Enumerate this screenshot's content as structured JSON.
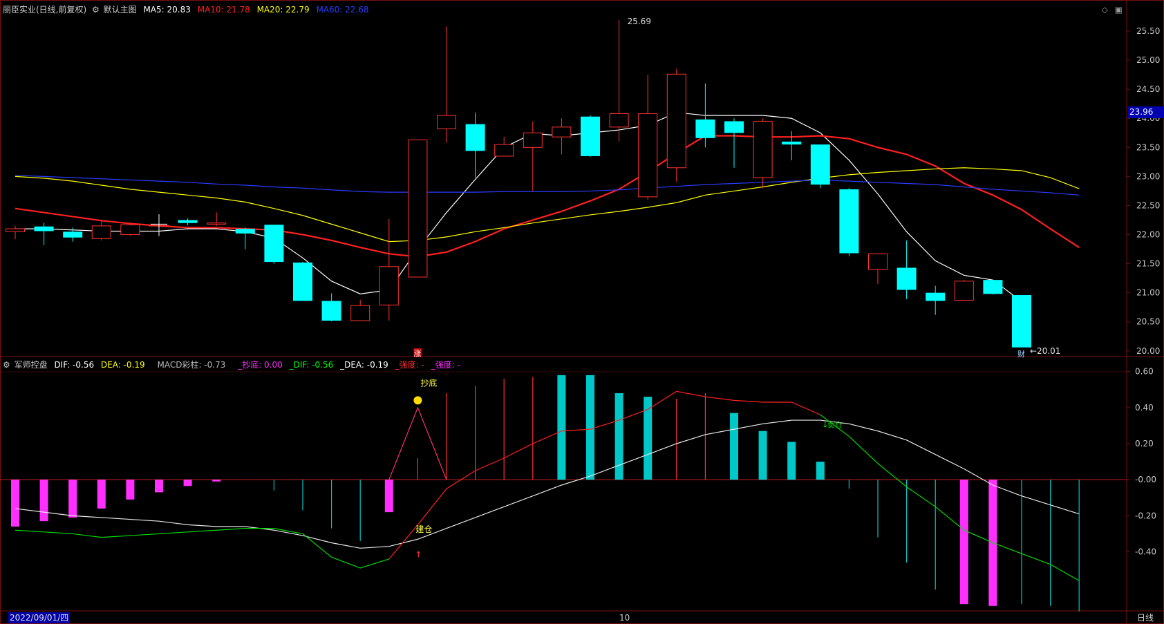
{
  "header": {
    "main": {
      "title": "丽臣实业(日线,前复权)",
      "template": "默认主图",
      "ma": [
        {
          "label": "MA5: 20.83",
          "color": "#ffffff"
        },
        {
          "label": "MA10: 21.78",
          "color": "#ff2020"
        },
        {
          "label": "MA20: 22.79",
          "color": "#ffff00"
        },
        {
          "label": "MA60: 22.68",
          "color": "#2b3cff"
        }
      ]
    },
    "sub": {
      "title": "军师控盘",
      "items": [
        {
          "label": "DIF: -0.56",
          "color": "#ffffff"
        },
        {
          "label": "DEA: -0.19",
          "color": "#ffff00"
        },
        {
          "label": "MACD彩柱: -0.73",
          "color": "#bbbbbb"
        },
        {
          "label": "_抄底: 0.00",
          "color": "#ff30ff"
        },
        {
          "label": "_DIF: -0.56",
          "color": "#00ff00"
        },
        {
          "label": "_DEA: -0.19",
          "color": "#ffffff"
        },
        {
          "label": "_强度: -",
          "color": "#ff3030"
        },
        {
          "label": "_强度: -",
          "color": "#ff30ff"
        }
      ]
    }
  },
  "colors": {
    "up": "#ff3232",
    "down": "#00ffff",
    "grid": "#7a1010",
    "axis_text": "#c8c8c8"
  },
  "price_axis": {
    "ticks": [
      "25.50",
      "25.00",
      "24.50",
      "24.00",
      "23.50",
      "23.00",
      "22.50",
      "22.00",
      "21.50",
      "21.00",
      "20.50",
      "20.00"
    ],
    "current_price": "23.96"
  },
  "sub_axis": {
    "ticks": [
      "0.60",
      "0.40",
      "0.20",
      "-0.00",
      "-0.20",
      "-0.40"
    ]
  },
  "chart_data": [
    {
      "type": "candlestick",
      "title": "丽臣实业(日线,前复权)",
      "ylim": [
        19.95,
        25.75
      ],
      "candles": [
        {
          "o": 22.05,
          "h": 22.15,
          "l": 21.92,
          "c": 22.1
        },
        {
          "o": 22.14,
          "h": 22.2,
          "l": 21.82,
          "c": 22.06
        },
        {
          "o": 22.05,
          "h": 22.12,
          "l": 21.88,
          "c": 21.95
        },
        {
          "o": 21.93,
          "h": 22.25,
          "l": 21.9,
          "c": 22.15
        },
        {
          "o": 22.0,
          "h": 22.2,
          "l": 21.98,
          "c": 22.17
        },
        {
          "o": 22.16,
          "h": 22.35,
          "l": 21.97,
          "c": 22.16
        },
        {
          "o": 22.25,
          "h": 22.28,
          "l": 22.16,
          "c": 22.2
        },
        {
          "o": 22.18,
          "h": 22.38,
          "l": 22.15,
          "c": 22.2
        },
        {
          "o": 22.1,
          "h": 22.12,
          "l": 21.75,
          "c": 22.02
        },
        {
          "o": 22.17,
          "h": 22.17,
          "l": 21.5,
          "c": 21.53
        },
        {
          "o": 21.52,
          "h": 21.53,
          "l": 20.86,
          "c": 20.86
        },
        {
          "o": 20.86,
          "h": 20.99,
          "l": 20.51,
          "c": 20.52
        },
        {
          "o": 20.52,
          "h": 20.88,
          "l": 20.52,
          "c": 20.78
        },
        {
          "o": 20.79,
          "h": 22.27,
          "l": 20.52,
          "c": 21.45
        },
        {
          "o": 21.27,
          "h": 22.45,
          "l": 21.27,
          "c": 23.63
        },
        {
          "o": 23.82,
          "h": 25.58,
          "l": 23.58,
          "c": 24.05
        },
        {
          "o": 23.9,
          "h": 24.1,
          "l": 22.98,
          "c": 23.44
        },
        {
          "o": 23.35,
          "h": 23.68,
          "l": 23.35,
          "c": 23.55
        },
        {
          "o": 23.5,
          "h": 23.95,
          "l": 22.75,
          "c": 23.75
        },
        {
          "o": 23.68,
          "h": 24.0,
          "l": 23.38,
          "c": 23.85
        },
        {
          "o": 24.03,
          "h": 24.05,
          "l": 23.34,
          "c": 23.35
        },
        {
          "o": 23.85,
          "h": 25.69,
          "l": 23.6,
          "c": 24.08
        },
        {
          "o": 22.65,
          "h": 24.75,
          "l": 22.6,
          "c": 24.08
        },
        {
          "o": 23.15,
          "h": 24.85,
          "l": 22.91,
          "c": 24.76
        },
        {
          "o": 23.98,
          "h": 24.6,
          "l": 23.5,
          "c": 23.66
        },
        {
          "o": 23.95,
          "h": 24.0,
          "l": 23.15,
          "c": 23.75
        },
        {
          "o": 22.98,
          "h": 24.0,
          "l": 22.8,
          "c": 23.95
        },
        {
          "o": 23.6,
          "h": 23.78,
          "l": 23.28,
          "c": 23.55
        },
        {
          "o": 23.55,
          "h": 23.55,
          "l": 22.8,
          "c": 22.86
        },
        {
          "o": 22.78,
          "h": 22.8,
          "l": 21.63,
          "c": 21.68
        },
        {
          "o": 21.4,
          "h": 21.68,
          "l": 21.15,
          "c": 21.67
        },
        {
          "o": 21.43,
          "h": 21.9,
          "l": 20.89,
          "c": 21.05
        },
        {
          "o": 21.0,
          "h": 21.12,
          "l": 20.62,
          "c": 20.86
        },
        {
          "o": 20.87,
          "h": 21.22,
          "l": 20.87,
          "c": 21.2
        },
        {
          "o": 21.22,
          "h": 21.22,
          "l": 20.97,
          "c": 20.98
        },
        {
          "o": 20.96,
          "h": 20.96,
          "l": 20.06,
          "c": 20.06
        }
      ],
      "ma_series": [
        {
          "name": "MA5",
          "color": "#ffffff",
          "values": [
            22.1,
            22.1,
            22.08,
            22.06,
            22.06,
            22.06,
            22.1,
            22.1,
            22.05,
            21.94,
            21.6,
            21.2,
            20.98,
            21.05,
            21.75,
            22.38,
            22.95,
            23.5,
            23.74,
            23.7,
            23.75,
            23.8,
            23.88,
            24.1,
            24.05,
            24.05,
            24.05,
            24.0,
            23.75,
            23.28,
            22.7,
            22.05,
            21.55,
            21.3,
            21.22,
            20.85
          ]
        },
        {
          "name": "MA10",
          "color": "#ff2020",
          "values": [
            22.45,
            22.38,
            22.31,
            22.24,
            22.19,
            22.15,
            22.12,
            22.12,
            22.1,
            22.08,
            22.0,
            21.9,
            21.78,
            21.67,
            21.62,
            21.7,
            21.88,
            22.1,
            22.25,
            22.4,
            22.58,
            22.78,
            23.08,
            23.4,
            23.7,
            23.7,
            23.68,
            23.68,
            23.7,
            23.65,
            23.5,
            23.38,
            23.18,
            22.88,
            22.68,
            22.43,
            22.1,
            21.78
          ]
        },
        {
          "name": "MA20",
          "color": "#ffff00",
          "values": [
            23.0,
            22.97,
            22.92,
            22.85,
            22.78,
            22.73,
            22.68,
            22.63,
            22.56,
            22.45,
            22.33,
            22.18,
            22.03,
            21.88,
            21.9,
            21.96,
            22.05,
            22.12,
            22.2,
            22.27,
            22.34,
            22.4,
            22.47,
            22.55,
            22.68,
            22.75,
            22.82,
            22.9,
            22.97,
            23.03,
            23.07,
            23.1,
            23.13,
            23.15,
            23.13,
            23.1,
            22.98,
            22.79
          ]
        },
        {
          "name": "MA60",
          "color": "#2b3cff",
          "values": [
            23.02,
            23.0,
            22.98,
            22.96,
            22.94,
            22.92,
            22.9,
            22.87,
            22.85,
            22.82,
            22.8,
            22.77,
            22.74,
            22.73,
            22.73,
            22.73,
            22.73,
            22.74,
            22.74,
            22.74,
            22.75,
            22.77,
            22.8,
            22.83,
            22.86,
            22.88,
            22.9,
            22.92,
            22.94,
            22.92,
            22.9,
            22.88,
            22.86,
            22.82,
            22.78,
            22.75,
            22.72,
            22.68
          ]
        }
      ],
      "annotations": [
        {
          "text": "25.69",
          "index": 21,
          "price": 25.69
        },
        {
          "text": "←20.01",
          "index": 35,
          "price": 20.01
        },
        {
          "text": "财",
          "index": 35,
          "position": "below-axis"
        },
        {
          "text": "涨",
          "index": 14,
          "position": "below-axis"
        }
      ]
    },
    {
      "type": "bar",
      "title": "军师控盘",
      "ylim": [
        -0.72,
        0.66
      ],
      "macd": [
        -0.26,
        -0.23,
        -0.21,
        -0.16,
        -0.11,
        -0.07,
        -0.035,
        -0.01,
        0,
        -0.06,
        -0.17,
        -0.27,
        -0.34,
        -0.18,
        0.12,
        0.48,
        0.52,
        0.56,
        0.57,
        0.58,
        0.58,
        0.48,
        0.46,
        0.45,
        0.48,
        0.37,
        0.27,
        0.21,
        0.1,
        -0.05,
        -0.32,
        -0.46,
        -0.61,
        -0.69,
        -0.7,
        -0.69,
        -0.7,
        -0.73
      ],
      "filled_macd_indices": [
        0,
        1,
        2,
        3,
        4,
        5,
        6,
        7,
        13,
        19,
        20,
        21,
        22,
        25,
        26,
        27,
        28,
        33,
        34
      ],
      "dif": [
        -0.16,
        -0.18,
        -0.2,
        -0.21,
        -0.22,
        -0.23,
        -0.25,
        -0.26,
        -0.26,
        -0.28,
        -0.31,
        -0.35,
        -0.38,
        -0.37,
        -0.33,
        -0.27,
        -0.21,
        -0.15,
        -0.09,
        -0.03,
        0.02,
        0.08,
        0.14,
        0.2,
        0.25,
        0.28,
        0.31,
        0.33,
        0.33,
        0.31,
        0.27,
        0.22,
        0.14,
        0.06,
        -0.03,
        -0.09,
        -0.14,
        -0.19
      ],
      "dea": [
        -0.28,
        -0.29,
        -0.3,
        -0.32,
        -0.31,
        -0.3,
        -0.29,
        -0.28,
        -0.27,
        -0.27,
        -0.3,
        -0.43,
        -0.49,
        -0.44,
        -0.25,
        -0.05,
        0.05,
        0.12,
        0.2,
        0.27,
        0.28,
        0.33,
        0.39,
        0.49,
        0.46,
        0.44,
        0.43,
        0.43,
        0.36,
        0.24,
        0.09,
        -0.04,
        -0.15,
        -0.28,
        -0.35,
        -0.41,
        -0.47,
        -0.56
      ],
      "dea_colors_split": 13,
      "annotations": [
        {
          "text": "抄底",
          "index": 14
        },
        {
          "text": "建仓",
          "index": 14
        },
        {
          "text": "卖仓",
          "index": 28
        }
      ]
    }
  ],
  "footer": {
    "date_label": "2022/09/01/四",
    "month_label": "10",
    "period_label": "日线"
  }
}
